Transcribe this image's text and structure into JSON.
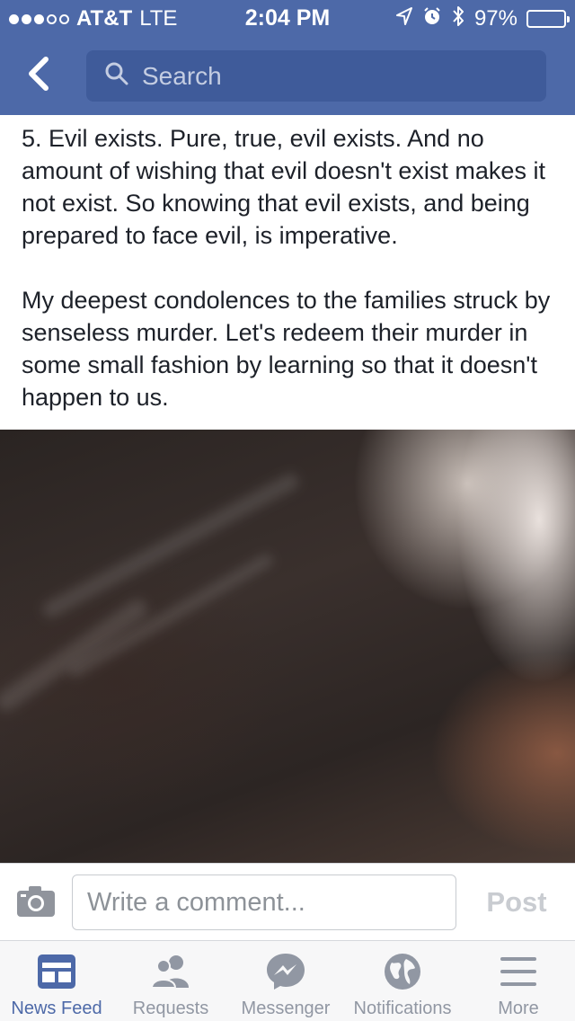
{
  "status_bar": {
    "carrier": "AT&T",
    "network": "LTE",
    "time": "2:04 PM",
    "battery_percent": "97%",
    "signal_bars_filled": 3,
    "signal_bars_total": 5,
    "icons": [
      "location-arrow-icon",
      "alarm-clock-icon",
      "bluetooth-icon",
      "battery-icon"
    ]
  },
  "nav": {
    "back_icon": "chevron-left-icon",
    "search_placeholder": "Search"
  },
  "post": {
    "paragraphs": [
      "5. Evil exists. Pure, true, evil exists. And no amount of wishing that evil doesn't exist makes it not exist. So knowing that evil exists, and being prepared to face evil, is imperative.",
      "My deepest condolences to the families struck by senseless murder. Let's redeem their murder in some small fashion by learning so that it doesn't happen to us."
    ]
  },
  "comment_bar": {
    "camera_icon": "camera-icon",
    "placeholder": "Write a comment...",
    "post_label": "Post"
  },
  "tabs": [
    {
      "label": "News Feed",
      "icon": "news-feed-icon",
      "active": true
    },
    {
      "label": "Requests",
      "icon": "friend-requests-icon",
      "active": false
    },
    {
      "label": "Messenger",
      "icon": "messenger-icon",
      "active": false
    },
    {
      "label": "Notifications",
      "icon": "globe-icon",
      "active": false
    },
    {
      "label": "More",
      "icon": "hamburger-menu-icon",
      "active": false
    }
  ],
  "colors": {
    "brand_blue": "#4d69a8",
    "search_field": "#3f5b9a",
    "inactive_tab": "#9197a3",
    "post_button_disabled": "#c9ccd1"
  }
}
